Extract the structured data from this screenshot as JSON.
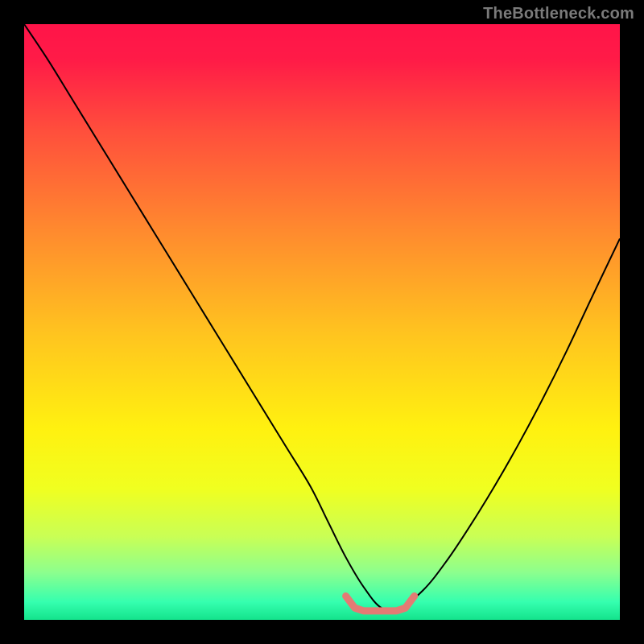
{
  "watermark": "TheBottleneck.com",
  "chart_data": {
    "type": "line",
    "title": "",
    "xlabel": "",
    "ylabel": "",
    "xlim": [
      0,
      100
    ],
    "ylim": [
      0,
      100
    ],
    "grid": false,
    "legend": false,
    "background_gradient": {
      "stops": [
        {
          "pos": 0.0,
          "color": "#ff1449"
        },
        {
          "pos": 0.06,
          "color": "#ff1b47"
        },
        {
          "pos": 0.18,
          "color": "#ff4f3c"
        },
        {
          "pos": 0.35,
          "color": "#ff8b2e"
        },
        {
          "pos": 0.52,
          "color": "#ffc41f"
        },
        {
          "pos": 0.68,
          "color": "#fff110"
        },
        {
          "pos": 0.78,
          "color": "#f0ff20"
        },
        {
          "pos": 0.86,
          "color": "#c9ff55"
        },
        {
          "pos": 0.92,
          "color": "#8dff8d"
        },
        {
          "pos": 0.97,
          "color": "#35ffaf"
        },
        {
          "pos": 1.0,
          "color": "#14e38c"
        }
      ]
    },
    "series": [
      {
        "name": "bottleneck-curve",
        "stroke": "#000000",
        "stroke_width": 2,
        "x": [
          0.0,
          4.0,
          8.0,
          12.0,
          16.0,
          20.0,
          24.0,
          28.0,
          32.0,
          36.0,
          40.0,
          44.0,
          48.0,
          51.0,
          54.0,
          57.0,
          60.0,
          63.0,
          67.0,
          71.0,
          75.0,
          79.0,
          83.0,
          87.0,
          91.0,
          95.0,
          100.0
        ],
        "y": [
          100.0,
          94.0,
          87.5,
          81.0,
          74.5,
          68.0,
          61.5,
          55.0,
          48.5,
          42.0,
          35.5,
          29.0,
          22.5,
          16.5,
          10.5,
          5.5,
          2.0,
          2.0,
          5.0,
          10.0,
          16.0,
          22.5,
          29.5,
          37.0,
          45.0,
          53.5,
          64.0
        ]
      },
      {
        "name": "optimal-zone-marker",
        "stroke": "#e47b74",
        "stroke_width": 9,
        "x": [
          54.0,
          55.5,
          57.0,
          60.0,
          62.5,
          64.0,
          65.5
        ],
        "y": [
          4.0,
          2.0,
          1.5,
          1.5,
          1.5,
          2.0,
          4.0
        ]
      }
    ]
  }
}
